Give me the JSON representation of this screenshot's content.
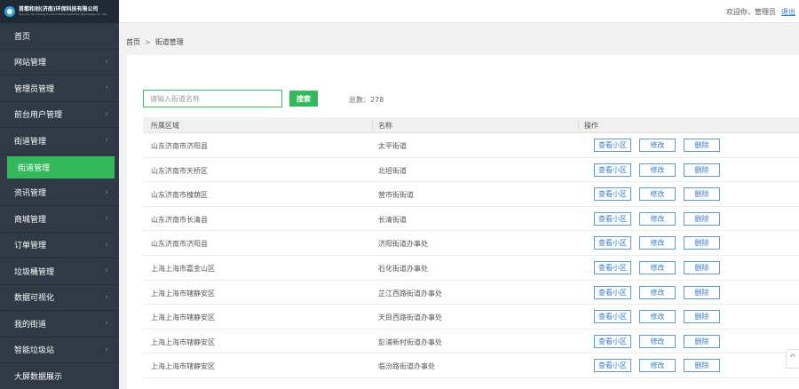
{
  "logo": {
    "name": "首都和创(济南)环保科技有限公司",
    "sub": "Shou Du He Chuang Environmental Protection Technology Co., Ltd."
  },
  "sidebar": {
    "items": [
      {
        "label": "首页",
        "arrow": ""
      },
      {
        "label": "网站管理",
        "arrow": "›"
      },
      {
        "label": "管理员管理",
        "arrow": "›"
      },
      {
        "label": "前台用户管理",
        "arrow": "›"
      },
      {
        "label": "街道管理",
        "arrow": "›"
      },
      {
        "label": "街道管理",
        "arrow": "",
        "active": true
      },
      {
        "label": "资讯管理",
        "arrow": "›"
      },
      {
        "label": "商城管理",
        "arrow": "›"
      },
      {
        "label": "订单管理",
        "arrow": "›"
      },
      {
        "label": "垃圾桶管理",
        "arrow": "›"
      },
      {
        "label": "数据可视化",
        "arrow": "›"
      },
      {
        "label": "我的街道",
        "arrow": "›"
      },
      {
        "label": "智能垃圾站",
        "arrow": "›"
      },
      {
        "label": "大屏数据展示",
        "arrow": ""
      }
    ]
  },
  "header": {
    "welcome": "欢迎你，管理员",
    "logout": "退出"
  },
  "breadcrumb": {
    "home": "首页",
    "separator": ">",
    "current": "街道管理"
  },
  "search": {
    "placeholder": "请输入街道名称",
    "value": "",
    "button": "搜索"
  },
  "total": {
    "label": "总数：",
    "count": "278"
  },
  "table": {
    "columns": [
      "所属区域",
      "名称",
      "操作"
    ],
    "actions": {
      "view": "查看小区",
      "edit": "修改",
      "delete": "删除"
    },
    "rows": [
      {
        "region": "山东济南市济阳县",
        "name": "太平街道"
      },
      {
        "region": "山东济南市天桥区",
        "name": "北坦街道"
      },
      {
        "region": "山东济南市槐荫区",
        "name": "营市街街道"
      },
      {
        "region": "山东济南市长清县",
        "name": "长清街道"
      },
      {
        "region": "山东济南市济阳县",
        "name": "济阳街道办事处"
      },
      {
        "region": "上海上海市嘉金山区",
        "name": "石化街道办事处"
      },
      {
        "region": "上海上海市辖静安区",
        "name": "芷江西路街道办事处"
      },
      {
        "region": "上海上海市辖静安区",
        "name": "天目西路街道办事处"
      },
      {
        "region": "上海上海市辖静安区",
        "name": "彭浦新村街道办事处"
      },
      {
        "region": "上海上海市辖静安区",
        "name": "临汾路街道办事处"
      }
    ]
  },
  "scroll_top": "^",
  "colors": {
    "sidebar": "#2f3a46",
    "accent": "#33b85c",
    "button_border": "#5c9ad6"
  }
}
